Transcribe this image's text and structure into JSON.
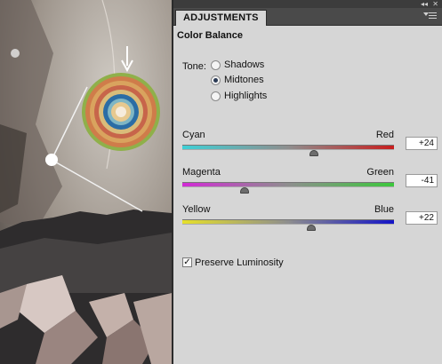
{
  "panel": {
    "tab_label": "ADJUSTMENTS",
    "title": "Color Balance",
    "tone": {
      "label": "Tone:",
      "options": [
        "Shadows",
        "Midtones",
        "Highlights"
      ],
      "selected": "Midtones"
    },
    "sliders": [
      {
        "left_label": "Cyan",
        "right_label": "Red",
        "value": "+24",
        "left_color": "#3fd0d6",
        "right_color": "#c81e1e"
      },
      {
        "left_label": "Magenta",
        "right_label": "Green",
        "value": "-41",
        "left_color": "#d22ad6",
        "right_color": "#3cc83c"
      },
      {
        "left_label": "Yellow",
        "right_label": "Blue",
        "value": "+22",
        "left_color": "#e6e02a",
        "right_color": "#1414c8"
      }
    ],
    "preserve_luminosity": {
      "label": "Preserve Luminosity",
      "checked": true
    }
  },
  "icons": {
    "collapse": "double-left-arrow-icon",
    "close": "close-icon",
    "menu": "panel-menu-icon"
  }
}
